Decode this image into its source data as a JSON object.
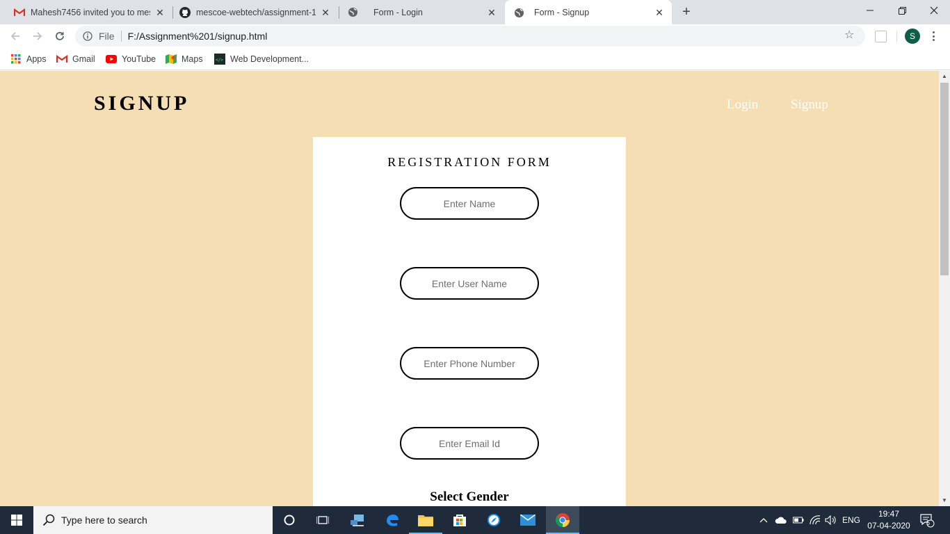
{
  "browser": {
    "tabs": [
      {
        "title": "Mahesh7456 invited you to mesc",
        "icon": "gmail-icon"
      },
      {
        "title": "mescoe-webtech/assignment-1-",
        "icon": "github-icon"
      },
      {
        "title": "Form - Login",
        "icon": "globe-icon"
      },
      {
        "title": "Form - Signup",
        "icon": "globe-icon",
        "active": true
      }
    ],
    "address": {
      "scheme_label": "File",
      "url": "F:/Assignment%201/signup.html"
    },
    "profile_initial": "S",
    "bookmarks": [
      {
        "label": "Apps",
        "icon": "apps-grid-icon"
      },
      {
        "label": "Gmail",
        "icon": "gmail-icon"
      },
      {
        "label": "YouTube",
        "icon": "youtube-icon"
      },
      {
        "label": "Maps",
        "icon": "maps-icon"
      },
      {
        "label": "Web Development...",
        "icon": "webdev-icon"
      }
    ]
  },
  "page": {
    "brand": "SIGNUP",
    "nav": {
      "login": "Login",
      "signup": "Signup"
    },
    "form": {
      "title": "REGISTRATION FORM",
      "fields": {
        "name": "Enter Name",
        "username": "Enter User Name",
        "phone": "Enter Phone Number",
        "email": "Enter Email Id"
      },
      "gender_label": "Select Gender"
    },
    "colors": {
      "background": "#f5deb3",
      "card": "#ffffff",
      "nav_text": "#ffffff"
    }
  },
  "taskbar": {
    "search_placeholder": "Type here to search",
    "language": "ENG",
    "time": "19:47",
    "date": "07-04-2020",
    "notification_count": "5"
  }
}
